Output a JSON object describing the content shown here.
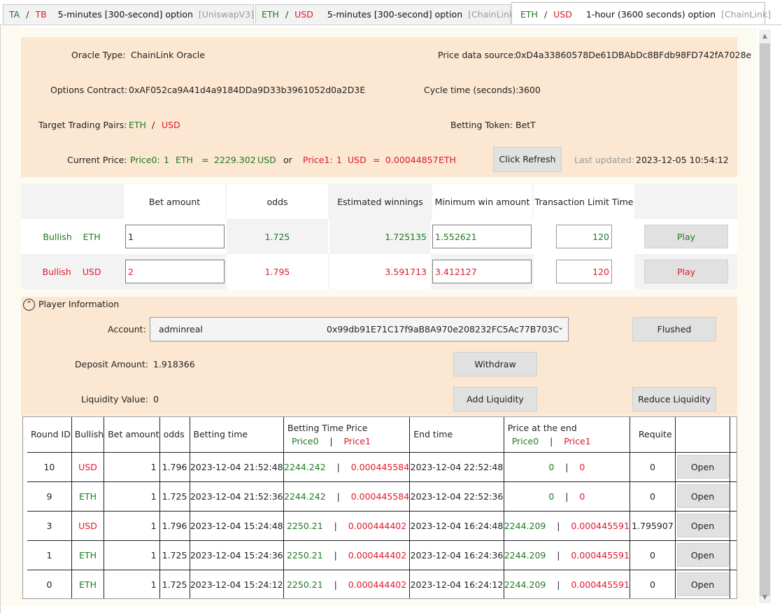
{
  "tabs": [
    {
      "a": "TA",
      "b": "TB",
      "name": "5-minutes [300-second] option",
      "source": "[UniswapV3]"
    },
    {
      "a": "ETH",
      "b": "USD",
      "name": "5-minutes [300-second] option",
      "source": "[ChainLink]"
    },
    {
      "a": "ETH",
      "b": "USD",
      "name": "1-hour (3600 seconds) option",
      "source": "[ChainLink]"
    }
  ],
  "tab_separator": "/",
  "info": {
    "oracle_type_label": "Oracle Type:",
    "oracle_type": "ChainLink Oracle",
    "price_source_label": "Price data source:",
    "price_source": "0xD4a33860578De61DBAbDc8BFdb98FD742fA7028e",
    "options_contract_label": "Options Contract:",
    "options_contract": "0xAF052ca9A41d4a9184DDa9D33b3961052d0a2D3E",
    "cycle_time_label": "Cycle time (seconds):",
    "cycle_time": "3600",
    "pairs_label": "Target Trading Pairs:",
    "pair_a": "ETH",
    "pair_sep": "/",
    "pair_b": "USD",
    "betting_token_label": "Betting Token:",
    "betting_token": "BetT",
    "current_price_label": "Current Price:",
    "price0_label": "Price0:",
    "price0_one": "1",
    "price0_a": "ETH",
    "eq": "=",
    "price0_value": "2229.302",
    "price0_b": "USD",
    "or": "or",
    "price1_label": "Price1:",
    "price1_one": "1",
    "price1_a": "USD",
    "price1_value": "0.00044857",
    "price1_b": "ETH",
    "refresh_label": "Click Refresh",
    "last_updated_label": "Last updated:",
    "last_updated": "2023-12-05 10:54:12"
  },
  "bet": {
    "headers": [
      "Bet amount",
      "odds",
      "Estimated winnings",
      "Minimum win amount",
      "Transaction Limit Time"
    ],
    "rows": [
      {
        "bull": "Bullish",
        "token": "ETH",
        "amount": "1",
        "odds": "1.725",
        "est": "1.725135",
        "min": "1.552621",
        "limit": "120",
        "play": "Play"
      },
      {
        "bull": "Bullish",
        "token": "USD",
        "amount": "2",
        "odds": "1.795",
        "est": "3.591713",
        "min": "3.412127",
        "limit": "120",
        "play": "Play"
      }
    ]
  },
  "player": {
    "section_label": "Player Information",
    "account_label": "Account:",
    "account_name": "adminreal",
    "account_address": "0x99db91E71C17f9aB8A970e208232FC5Ac77B703C",
    "flushed": "Flushed",
    "deposit_label": "Deposit Amount:",
    "deposit": "1.918366",
    "withdraw": "Withdraw",
    "liquidity_label": "Liquidity Value:",
    "liquidity": "0",
    "add_liquidity": "Add Liquidity",
    "reduce_liquidity": "Reduce Liquidity"
  },
  "rounds": {
    "headers": {
      "round": "Round ID",
      "bullish": "Bullish",
      "amount": "Bet amount",
      "odds": "odds",
      "time": "Betting time",
      "btp": "Betting Time Price",
      "end": "End time",
      "pend": "Price at the end",
      "requite": "Requite",
      "p0": "Price0",
      "p1": "Price1",
      "sep": "|"
    },
    "rows": [
      {
        "id": "10",
        "bull": "USD",
        "amount": "1",
        "odds": "1.796",
        "time": "2023-12-04 21:52:48",
        "bp0": "2244.242",
        "bp1": "0.000445584",
        "end": "2023-12-04 22:52:48",
        "ep0": "0",
        "ep1": "0",
        "requite": "0",
        "btn": "Open"
      },
      {
        "id": "9",
        "bull": "ETH",
        "amount": "1",
        "odds": "1.725",
        "time": "2023-12-04 21:52:36",
        "bp0": "2244.242",
        "bp1": "0.000445584",
        "end": "2023-12-04 22:52:36",
        "ep0": "0",
        "ep1": "0",
        "requite": "0",
        "btn": "Open"
      },
      {
        "id": "3",
        "bull": "USD",
        "amount": "1",
        "odds": "1.796",
        "time": "2023-12-04 15:24:48",
        "bp0": "2250.21",
        "bp1": "0.000444402",
        "end": "2023-12-04 16:24:48",
        "ep0": "2244.209",
        "ep1": "0.000445591",
        "requite": "1.795907",
        "btn": "Open"
      },
      {
        "id": "1",
        "bull": "ETH",
        "amount": "1",
        "odds": "1.725",
        "time": "2023-12-04 15:24:36",
        "bp0": "2250.21",
        "bp1": "0.000444402",
        "end": "2023-12-04 16:24:36",
        "ep0": "2244.209",
        "ep1": "0.000445591",
        "requite": "0",
        "btn": "Open"
      },
      {
        "id": "0",
        "bull": "ETH",
        "amount": "1",
        "odds": "1.725",
        "time": "2023-12-04 15:24:12",
        "bp0": "2250.21",
        "bp1": "0.000444402",
        "end": "2023-12-04 16:24:12",
        "ep0": "2244.209",
        "ep1": "0.000445591",
        "requite": "0",
        "btn": "Open"
      }
    ]
  },
  "colors": {
    "bullish_eth": "#1f7a1f",
    "bullish_usd": "#e0182b",
    "panel": "#fbe7d2",
    "background": "#fdfaf1"
  }
}
